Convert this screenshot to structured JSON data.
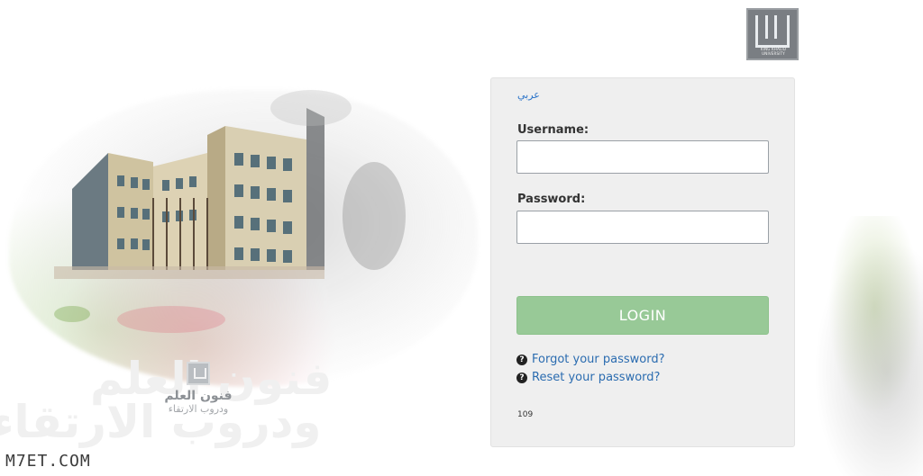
{
  "language_toggle": "عربي",
  "form": {
    "username_label": "Username:",
    "username_value": "",
    "password_label": "Password:",
    "password_value": "",
    "login_button": "LOGIN",
    "forgot_link": "Forgot your password?",
    "reset_link": "Reset your password?",
    "code": "109"
  },
  "tagline": {
    "line1": "فنون العلم",
    "line2": "ودروب الارتقاء"
  },
  "watermark": "M7ET.COM",
  "colors": {
    "panel_bg": "#efefef",
    "login_button": "#98c997",
    "link": "#2b6cb0"
  },
  "icons": [
    "university-logo",
    "question-circle-icon",
    "building-illustration"
  ]
}
